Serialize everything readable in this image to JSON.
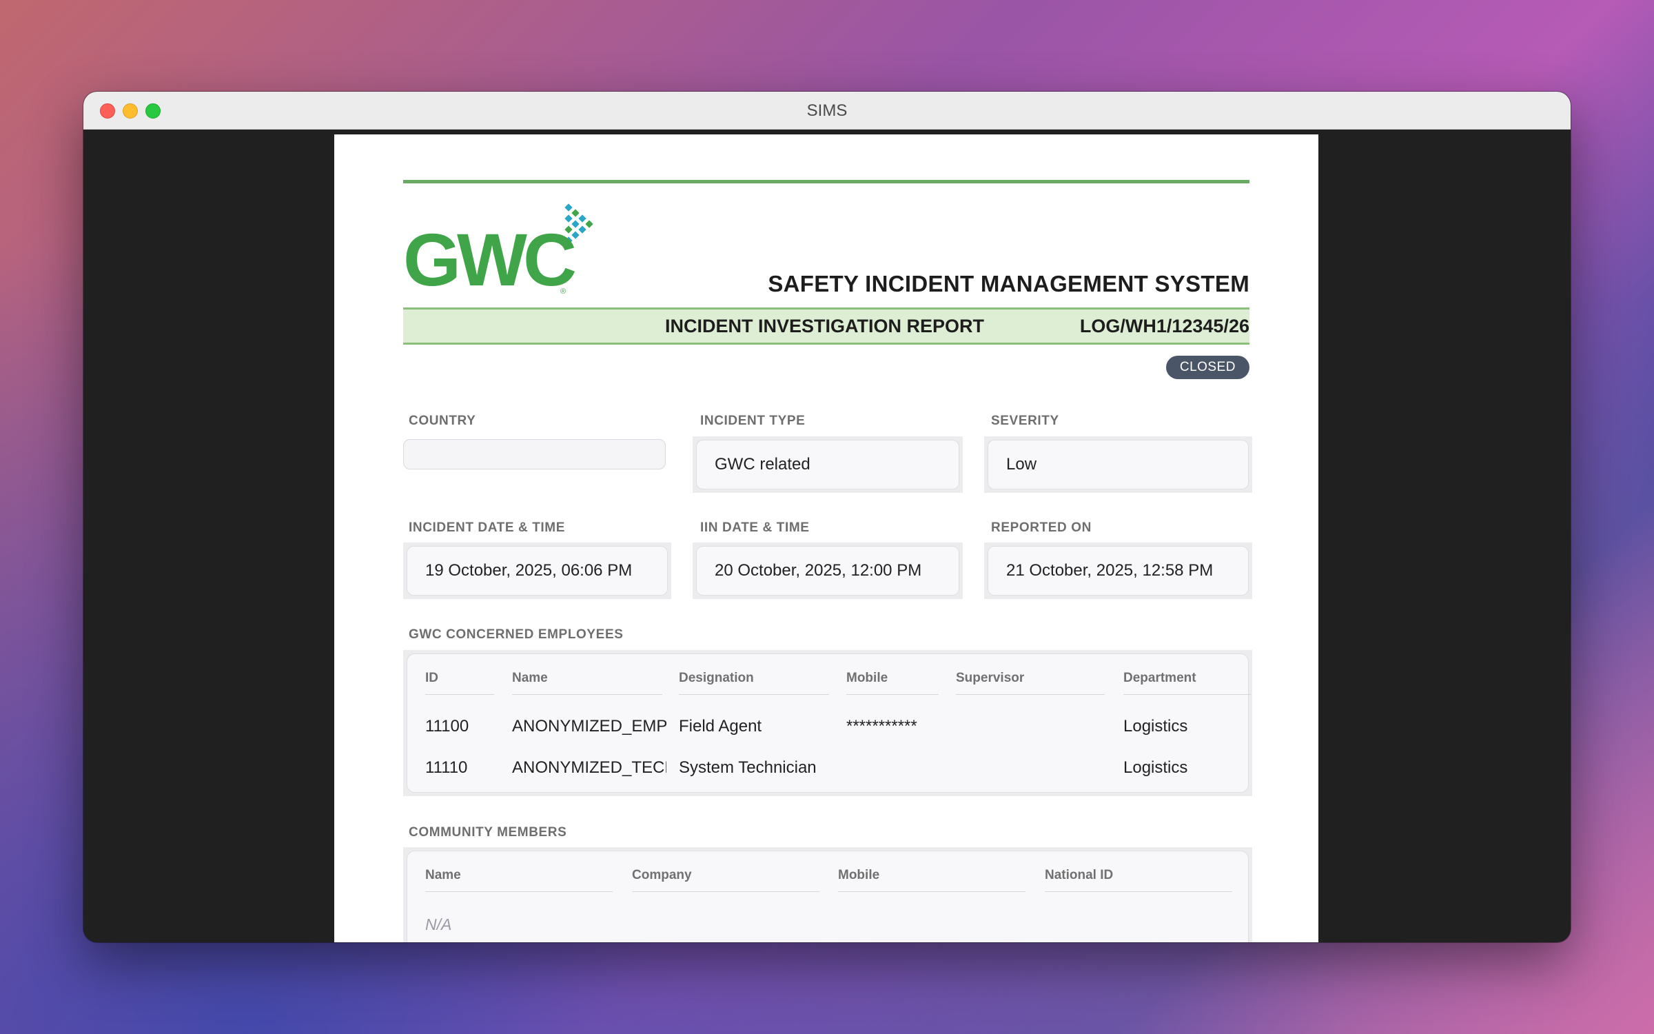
{
  "window": {
    "title": "SIMS"
  },
  "report": {
    "logo_text": "GWC",
    "system_title": "SAFETY INCIDENT MANAGEMENT SYSTEM",
    "report_title": "INCIDENT INVESTIGATION REPORT",
    "reference": "LOG/WH1/12345/26",
    "status": "CLOSED"
  },
  "fields": {
    "country": {
      "label": "COUNTRY",
      "value": ""
    },
    "incident_type": {
      "label": "INCIDENT TYPE",
      "value": "GWC related"
    },
    "severity": {
      "label": "SEVERITY",
      "value": "Low"
    },
    "incident_datetime": {
      "label": "INCIDENT DATE & TIME",
      "value": "19 October, 2025, 06:06 PM"
    },
    "iin_datetime": {
      "label": "IIN DATE & TIME",
      "value": "20 October, 2025, 12:00 PM"
    },
    "reported_on": {
      "label": "REPORTED ON",
      "value": "21 October, 2025, 12:58 PM"
    }
  },
  "employees": {
    "label": "GWC CONCERNED EMPLOYEES",
    "columns": [
      "ID",
      "Name",
      "Designation",
      "Mobile",
      "Supervisor",
      "Department"
    ],
    "rows": [
      [
        "11100",
        "ANONYMIZED_EMPL",
        "Field Agent",
        "***********",
        "",
        "Logistics"
      ],
      [
        "11110",
        "ANONYMIZED_TECH",
        "System Technician",
        "",
        "",
        "Logistics"
      ]
    ]
  },
  "community": {
    "label": "COMMUNITY MEMBERS",
    "columns": [
      "Name",
      "Company",
      "Mobile",
      "National ID"
    ],
    "empty_text": "N/A"
  },
  "colors": {
    "brand_green": "#3fa548",
    "band_green": "#deeed5",
    "status_badge": "#4a5568",
    "logo_dots": "#2aa5c8"
  }
}
